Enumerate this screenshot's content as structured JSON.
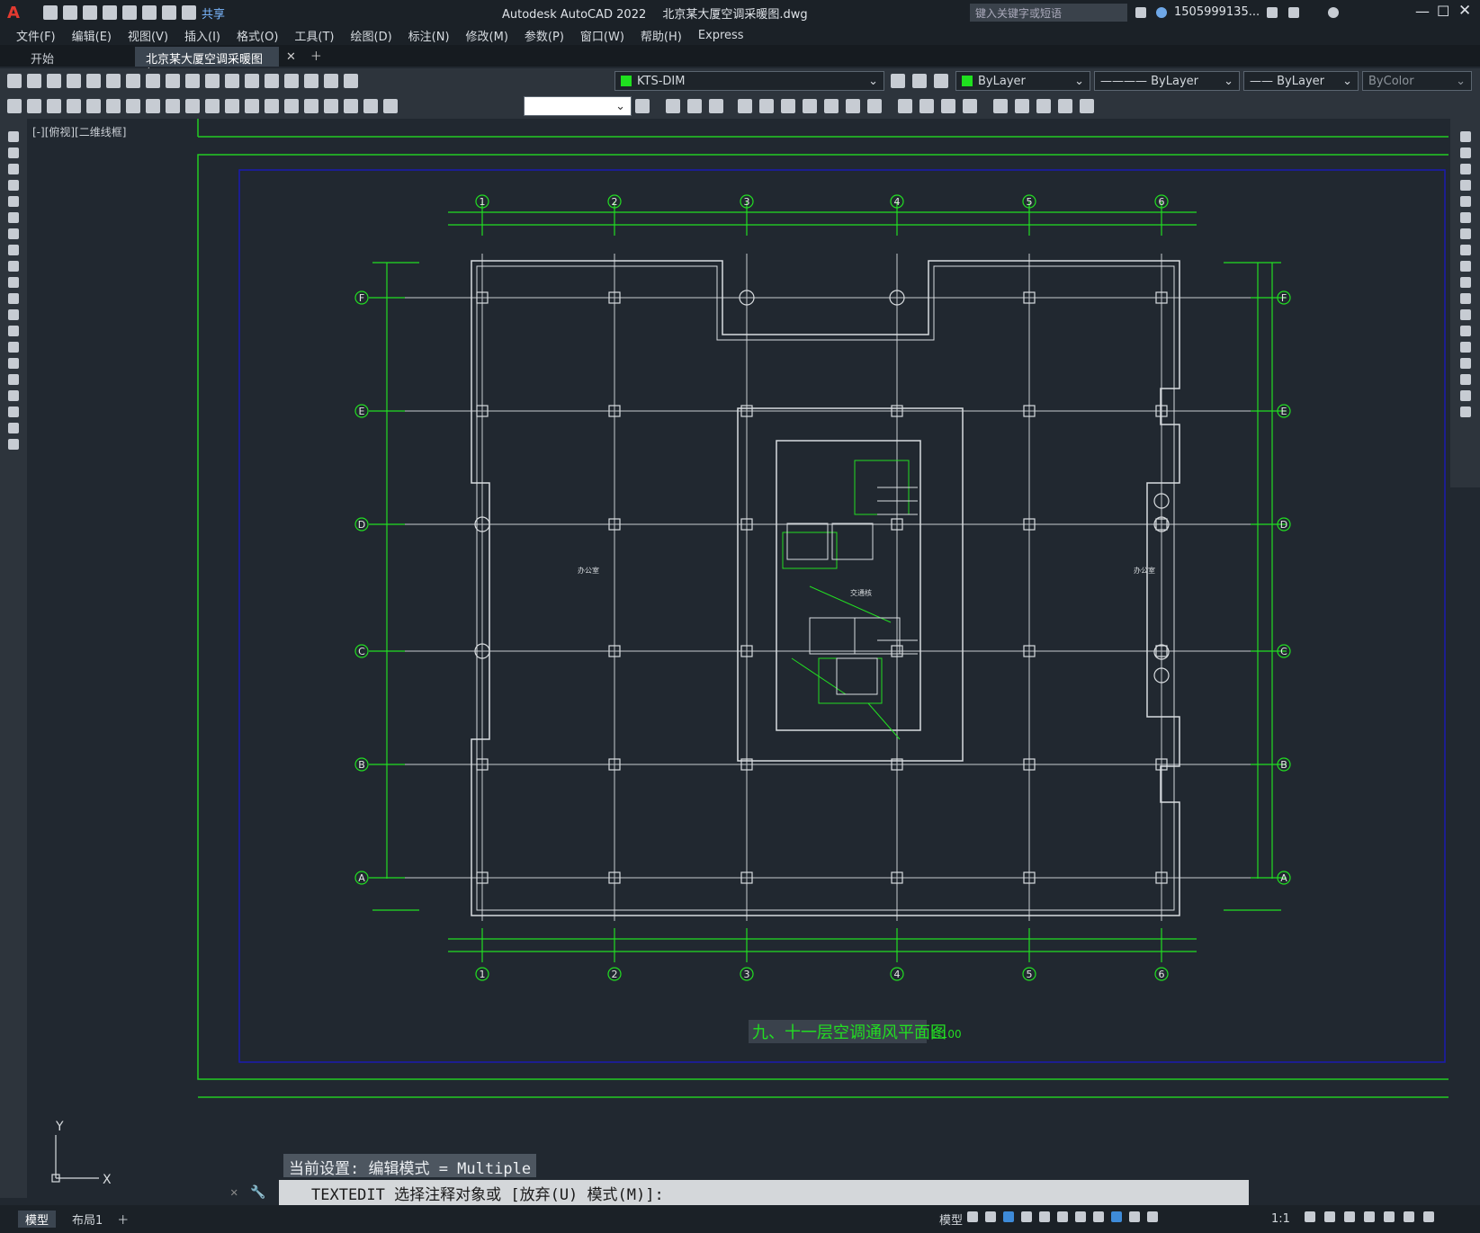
{
  "app": {
    "title": "Autodesk AutoCAD 2022",
    "filename": "北京某大厦空调采暖图.dwg",
    "search_placeholder": "键入关键字或短语",
    "user": "1505999135...",
    "share_label": "共享"
  },
  "menu": [
    "文件(F)",
    "编辑(E)",
    "视图(V)",
    "插入(I)",
    "格式(O)",
    "工具(T)",
    "绘图(D)",
    "标注(N)",
    "修改(M)",
    "参数(P)",
    "窗口(W)",
    "帮助(H)",
    "Express"
  ],
  "tabs": [
    {
      "label": "开始"
    },
    {
      "label": "北京某大厦空调采暖图*"
    }
  ],
  "toolbar": {
    "layer": "KTS-DIM",
    "color": "ByLayer",
    "linetype": "ByLayer",
    "lineweight": "ByLayer",
    "plotstyle": "ByColor"
  },
  "viewport_label": "[-][俯视][二维线框]",
  "drawing": {
    "axes_numbers": [
      "1",
      "2",
      "3",
      "4",
      "5",
      "6"
    ],
    "axes_letters": [
      "F",
      "E",
      "D",
      "C",
      "B",
      "A"
    ],
    "room_label_left": "办公室",
    "room_label_right": "办公室",
    "core_label": "交通核",
    "title": "九、十一层空调通风平面图",
    "scale": "1:100"
  },
  "command": {
    "history": "当前设置: 编辑模式 = Multiple",
    "prompt": "TEXTEDIT 选择注释对象或 [放弃(U) 模式(M)]:"
  },
  "ucs": {
    "x": "X",
    "y": "Y"
  },
  "status": {
    "model_tab": "模型",
    "layout_tab": "布局1",
    "model_label": "模型",
    "scale": "1:1"
  }
}
